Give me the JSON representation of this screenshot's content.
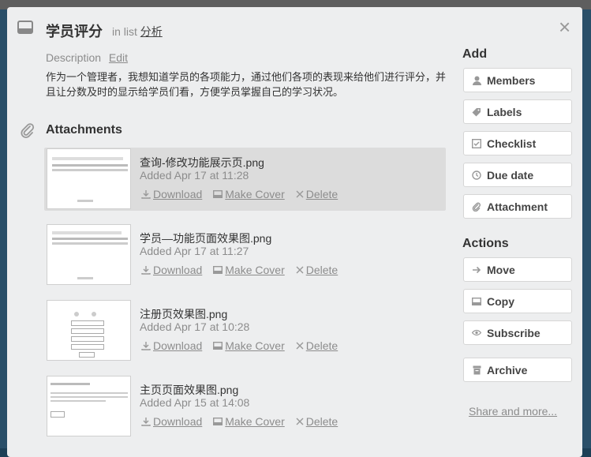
{
  "card": {
    "title": "学员评分",
    "in_list_prefix": "in list",
    "list_name": "分析",
    "close_glyph": "×"
  },
  "description": {
    "label": "Description",
    "edit_label": "Edit",
    "text": "作为一个管理者，我想知道学员的各项能力，通过他们各项的表现来给他们进行评分，并且让分数及时的显示给学员们看，方便学员掌握自己的学习状况。"
  },
  "attachments": {
    "heading": "Attachments",
    "items": [
      {
        "name": "查询-修改功能展示页.png",
        "added": "Added Apr 17 at 11:28",
        "download": "Download",
        "make_cover": "Make Cover",
        "delete": "Delete"
      },
      {
        "name": "学员—功能页面效果图.png",
        "added": "Added Apr 17 at 11:27",
        "download": "Download",
        "make_cover": "Make Cover",
        "delete": "Delete"
      },
      {
        "name": "注册页效果图.png",
        "added": "Added Apr 17 at 10:28",
        "download": "Download",
        "make_cover": "Make Cover",
        "delete": "Delete"
      },
      {
        "name": "主页页面效果图.png",
        "added": "Added Apr 15 at 14:08",
        "download": "Download",
        "make_cover": "Make Cover",
        "delete": "Delete"
      }
    ]
  },
  "sidebar": {
    "add_heading": "Add",
    "add_buttons": [
      {
        "label": "Members",
        "icon": "person-icon"
      },
      {
        "label": "Labels",
        "icon": "tag-icon"
      },
      {
        "label": "Checklist",
        "icon": "checkbox-icon"
      },
      {
        "label": "Due date",
        "icon": "clock-icon"
      },
      {
        "label": "Attachment",
        "icon": "paperclip-icon"
      }
    ],
    "actions_heading": "Actions",
    "action_buttons": [
      {
        "label": "Move",
        "icon": "arrow-right-icon"
      },
      {
        "label": "Copy",
        "icon": "card-icon"
      },
      {
        "label": "Subscribe",
        "icon": "eye-icon"
      },
      {
        "label": "Archive",
        "icon": "archive-icon"
      }
    ],
    "share_label": "Share and more..."
  }
}
